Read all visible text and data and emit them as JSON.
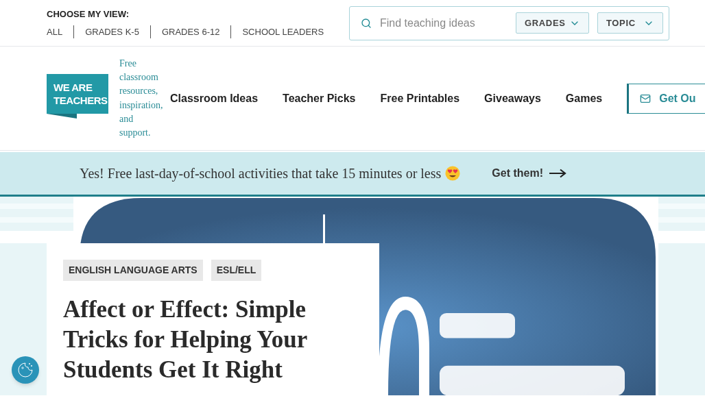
{
  "view_switcher": {
    "label": "CHOOSE MY VIEW:",
    "options": [
      "ALL",
      "GRADES K-5",
      "GRADES 6-12",
      "SCHOOL LEADERS"
    ]
  },
  "search": {
    "placeholder": "Find teaching ideas",
    "filters": [
      "GRADES",
      "TOPIC"
    ]
  },
  "logo": {
    "lines": [
      "WE ARE",
      "TEACHERS"
    ],
    "tagline": "Free classroom resources, inspiration, and support."
  },
  "nav": {
    "items": [
      "Classroom Ideas",
      "Teacher Picks",
      "Free Printables",
      "Giveaways",
      "Games"
    ],
    "cta": "Get Ou"
  },
  "banner": {
    "text": "Yes! Free last-day-of-school activities that take 15 minutes or less",
    "link": "Get them!"
  },
  "article": {
    "tags": [
      "ENGLISH LANGUAGE ARTS",
      "ESL/ELL"
    ],
    "title": "Affect or Effect: Simple Tricks for Helping Your Students Get It Right"
  }
}
